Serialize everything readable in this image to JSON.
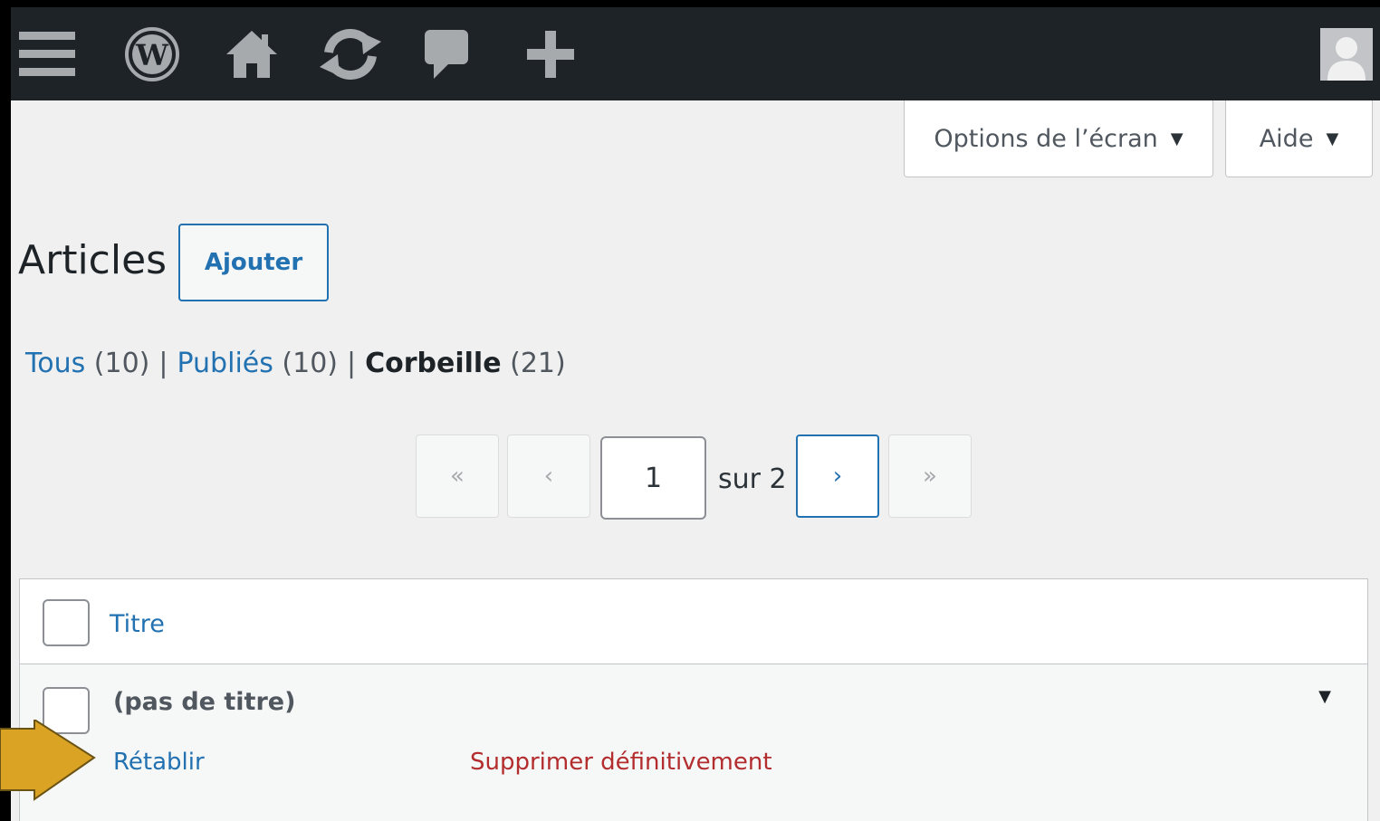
{
  "admin_bar": {
    "icons": [
      "menu-icon",
      "wordpress-logo-icon",
      "home-icon",
      "updates-icon",
      "comments-icon",
      "new-content-icon",
      "avatar-icon"
    ]
  },
  "screen_meta": {
    "screen_options_label": "Options de l’écran",
    "help_label": "Aide",
    "arrow": "▼"
  },
  "heading": {
    "title": "Articles",
    "add_new_label": "Ajouter"
  },
  "views": [
    {
      "label": "Tous",
      "count": "(10)"
    },
    {
      "label": "Publiés",
      "count": "(10)"
    },
    {
      "label": "Corbeille",
      "count": "(21)",
      "current": true
    }
  ],
  "views_separator": "|",
  "pagination": {
    "first": "«",
    "prev": "‹",
    "current_page": "1",
    "of_text": "sur 2",
    "next": "›",
    "last": "»"
  },
  "table": {
    "column_title": "Titre",
    "rows": [
      {
        "title": "(pas de titre)",
        "toggle": "▼",
        "actions": {
          "restore": "Rétablir",
          "delete": "Supprimer définitivement"
        }
      }
    ]
  },
  "colors": {
    "admin_bar_bg": "#1d2327",
    "link": "#2271b1",
    "delete": "#b32d2e",
    "page_bg": "#f0f0f1",
    "callout_arrow": "#dba324"
  }
}
